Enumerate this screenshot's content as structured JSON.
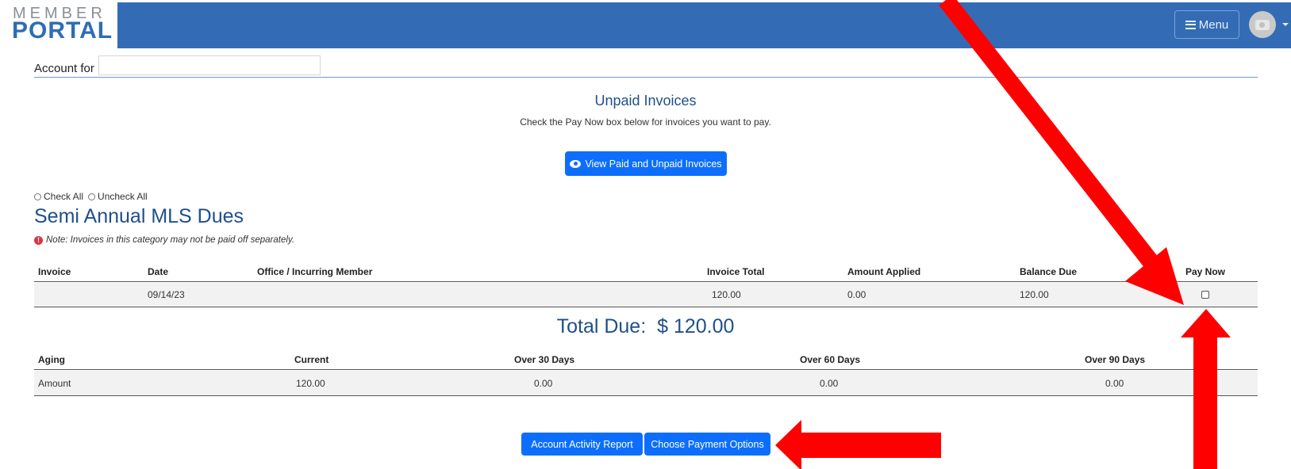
{
  "header": {
    "logo_top": "MEMBER",
    "logo_bottom": "PORTAL",
    "menu_label": "Menu"
  },
  "account": {
    "label": "Account for",
    "value": ""
  },
  "unpaid": {
    "title": "Unpaid Invoices",
    "subtitle": "Check the Pay Now box below for invoices you want to pay.",
    "view_button": "View Paid and Unpaid Invoices"
  },
  "selection": {
    "check_all": "Check All",
    "uncheck_all": "Uncheck All"
  },
  "section": {
    "title": "Semi Annual MLS Dues",
    "note": "Note: Invoices in this category may not be paid off separately."
  },
  "invoice_table": {
    "headers": [
      "Invoice",
      "Date",
      "Office / Incurring Member",
      "Invoice Total",
      "Amount Applied",
      "Balance Due",
      "Pay Now"
    ],
    "rows": [
      {
        "invoice": "",
        "date": "09/14/23",
        "office": "",
        "invoice_total": "120.00",
        "amount_applied": "0.00",
        "balance_due": "120.00",
        "pay_now": false
      }
    ]
  },
  "total_due": {
    "label": "Total Due:",
    "amount": "$ 120.00"
  },
  "aging_table": {
    "headers": [
      "Aging",
      "Current",
      "Over 30 Days",
      "Over 60 Days",
      "Over 90 Days"
    ],
    "row": [
      "Amount",
      "120.00",
      "0.00",
      "0.00",
      "0.00"
    ]
  },
  "buttons": {
    "account_activity": "Account Activity Report",
    "choose_payment": "Choose Payment Options"
  },
  "colors": {
    "topbar": "#336cb5",
    "primary_button": "#0d6efd",
    "heading": "#1f4f8c",
    "annotation_arrow": "#ff0000"
  }
}
